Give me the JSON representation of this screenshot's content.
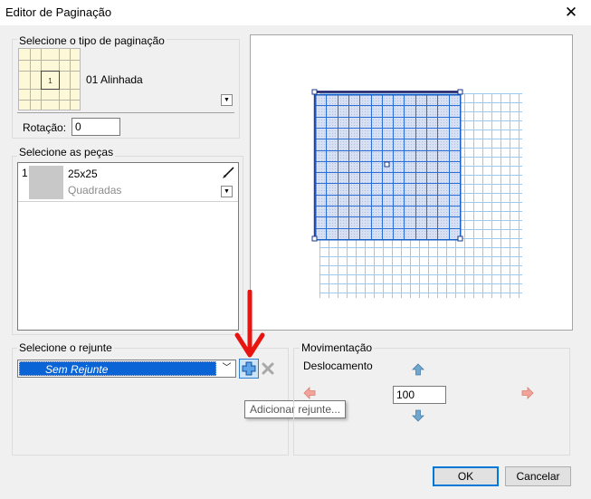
{
  "window": {
    "title": "Editor de Paginação"
  },
  "paging_type": {
    "group_label": "Selecione o tipo de paginação",
    "selected_label": "01 Alinhada",
    "rotation_label": "Rotação:",
    "rotation_value": "0"
  },
  "pieces": {
    "group_label": "Selecione as peças",
    "items": [
      {
        "index": "1",
        "size": "25x25",
        "type": "Quadradas"
      }
    ]
  },
  "grout": {
    "group_label": "Selecione o rejunte",
    "selected_value": "Sem Rejunte",
    "tooltip": "Adicionar rejunte..."
  },
  "movement": {
    "group_label": "Movimentação",
    "offset_label": "Deslocamento",
    "offset_value": "100"
  },
  "buttons": {
    "ok": "OK",
    "cancel": "Cancelar"
  },
  "colors": {
    "selection_blue": "#0a64d6",
    "grid_blue": "#9cc8ee",
    "tile_fill": "#d7e0f3",
    "annotation_red": "#e8140f"
  },
  "icons": {
    "brush": "brush-icon",
    "add": "plus-icon",
    "remove": "x-icon",
    "move_up": "arrow-up-icon",
    "move_down": "arrow-down-icon",
    "move_left": "arrow-left-icon",
    "move_right": "arrow-right-icon",
    "annotation": "red-arrow-icon"
  }
}
